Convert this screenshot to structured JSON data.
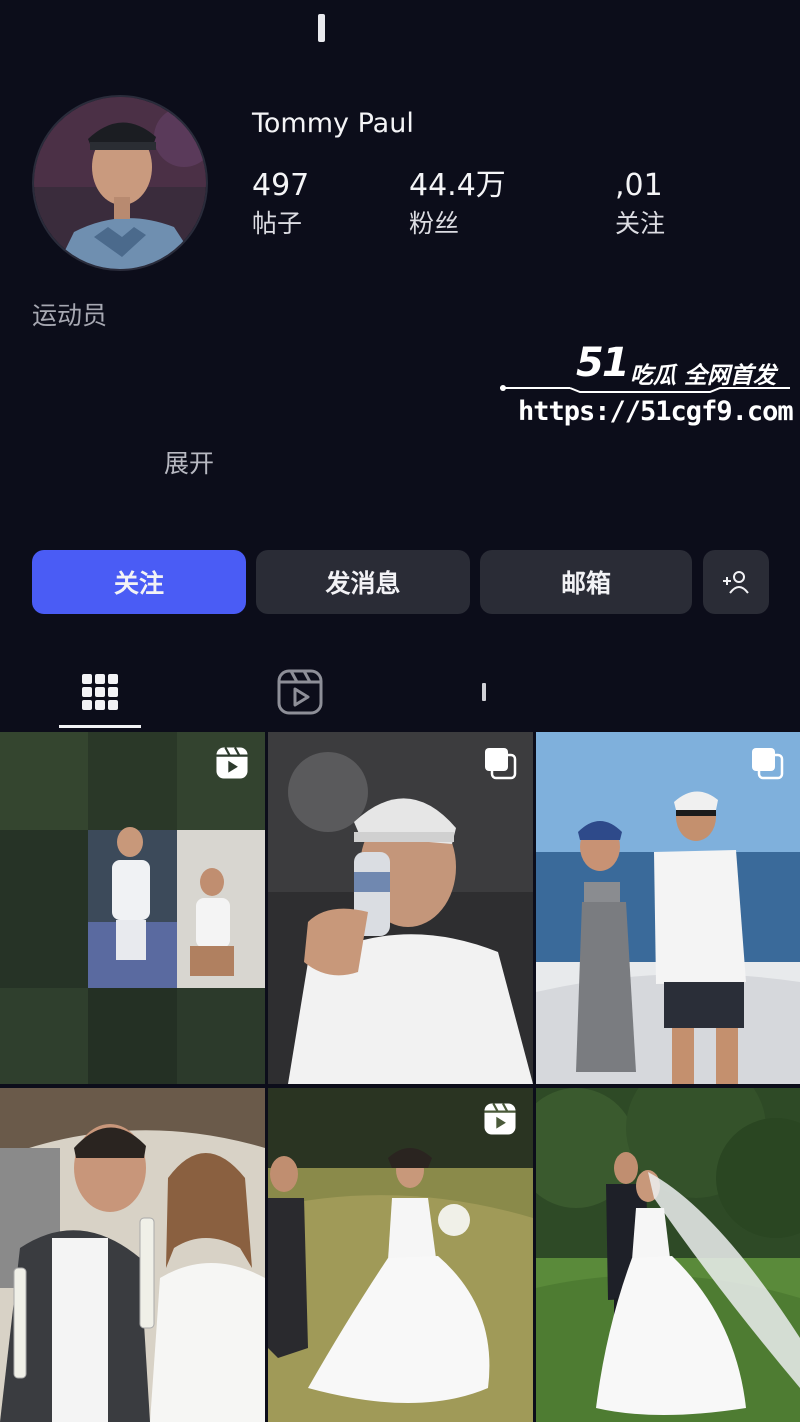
{
  "profile": {
    "username": "Tommy Paul",
    "category": "运动员",
    "expand_label": "展开"
  },
  "stats": [
    {
      "value": "497",
      "label": "帖子"
    },
    {
      "value": "44.4万",
      "label": "粉丝"
    },
    {
      "value": ",01",
      "label": "关注"
    }
  ],
  "actions": {
    "follow": "关注",
    "message": "发消息",
    "email": "邮箱"
  },
  "tabs": [
    "grid-icon",
    "reels-icon",
    "tagged-icon"
  ],
  "watermark": {
    "logo": "51",
    "title": "吃瓜 全网首发",
    "url": "https://51cgf9.com"
  },
  "posts": [
    {
      "type": "reel",
      "desc": "tennis photo collage"
    },
    {
      "type": "carousel",
      "desc": "drinking from can"
    },
    {
      "type": "carousel",
      "desc": "couple on boat"
    },
    {
      "type": "photo",
      "desc": "couple in car with champagne"
    },
    {
      "type": "reel",
      "desc": "wedding couple walking"
    },
    {
      "type": "photo",
      "desc": "wedding couple under trees"
    }
  ],
  "colors": {
    "background": "#0c0d1a",
    "follow_button": "#4a5cf5",
    "secondary_button": "#2a2c36"
  }
}
